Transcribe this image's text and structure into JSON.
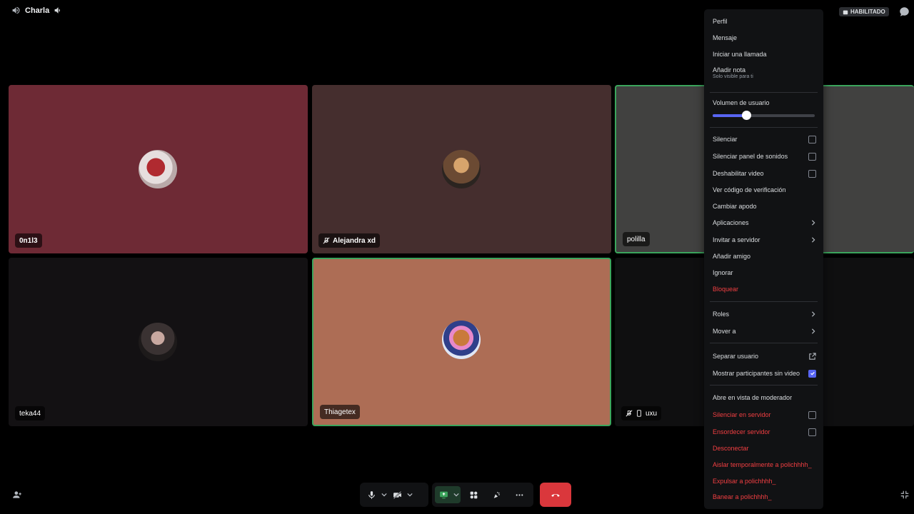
{
  "channel": {
    "name": "Charla"
  },
  "badge": {
    "label": "HABILITADO"
  },
  "tiles": [
    {
      "name": "0n1l3",
      "bg": "#6e2a35"
    },
    {
      "name": "Alejandra xd",
      "bg": "#452e2e"
    },
    {
      "name": "polilla",
      "bg": "#414140"
    },
    {
      "name": "teka44",
      "bg": "#131113"
    },
    {
      "name": "Thiagetex",
      "bg": "#ad6d55"
    },
    {
      "name": "uxu",
      "bg": "#0f0f10"
    }
  ],
  "menu": {
    "profile": "Perfil",
    "message": "Mensaje",
    "call": "Iniciar una llamada",
    "add_note": "Añadir nota",
    "note_hint": "Solo visible para ti",
    "volume_label": "Volumen de usuario",
    "volume_level": 0.33,
    "mute": "Silenciar",
    "mute_soundboard": "Silenciar panel de sonidos",
    "disable_video": "Deshabilitar video",
    "verification": "Ver código de verificación",
    "nickname": "Cambiar apodo",
    "apps": "Aplicaciones",
    "invite": "Invitar a servidor",
    "add_friend": "Añadir amigo",
    "ignore": "Ignorar",
    "block": "Bloquear",
    "roles": "Roles",
    "move": "Mover a",
    "pop_out": "Separar usuario",
    "show_no_video": "Mostrar participantes sin video",
    "moderator_view": "Abre en vista de moderador",
    "server_mute": "Silenciar en servidor",
    "server_deafen": "Ensordecer servidor",
    "disconnect": "Desconectar",
    "timeout": "Aislar temporalmente a polichhhh_",
    "kick": "Expulsar a polichhhh_",
    "ban": "Banear a polichhhh_"
  },
  "colors": {
    "accent": "#5865f2",
    "danger": "#f23f42",
    "speaking": "#3ba55c",
    "end_call": "#da373c"
  }
}
